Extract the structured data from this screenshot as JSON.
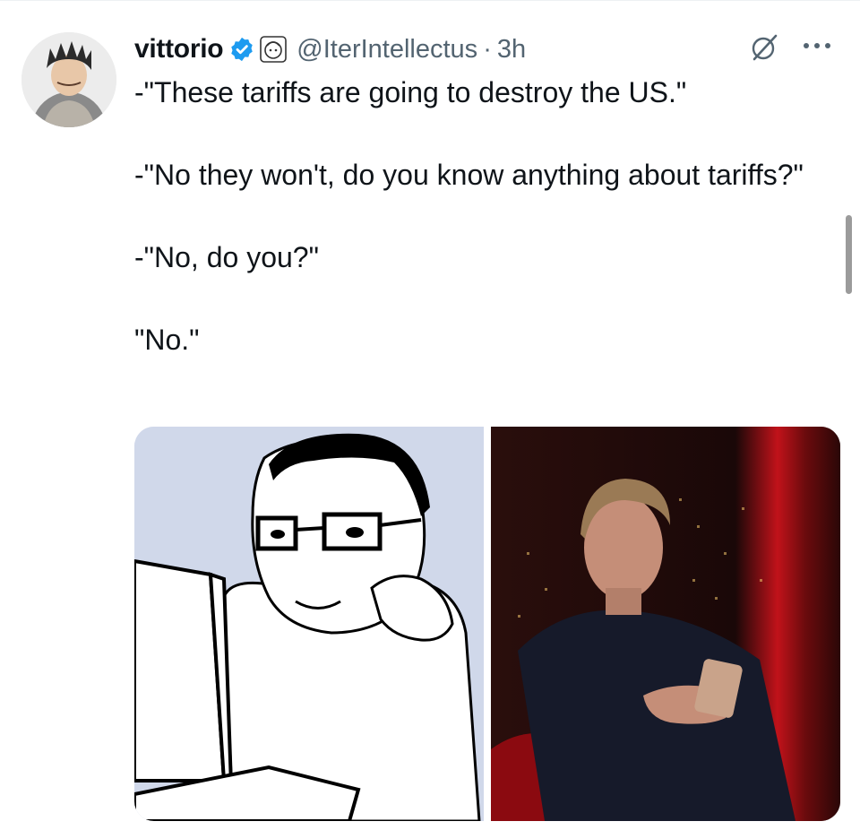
{
  "author": {
    "display_name": "vittorio",
    "handle": "@IterIntellectus",
    "separator": "·",
    "timestamp": "3h"
  },
  "icons": {
    "verified": "verified-badge-icon",
    "affiliation": "affiliation-avatar-icon",
    "grok": "grok-icon",
    "more": "more-options-icon"
  },
  "tweet": {
    "lines": [
      "-\"These tariffs are going to destroy the US.\"",
      "-\"No they won't, do you know anything about tariffs?\"",
      "-\"No, do you?\"",
      "\"No.\""
    ]
  },
  "colors": {
    "verified": "#1d9bf0",
    "secondary_text": "#536471",
    "primary_text": "#0f1419"
  }
}
